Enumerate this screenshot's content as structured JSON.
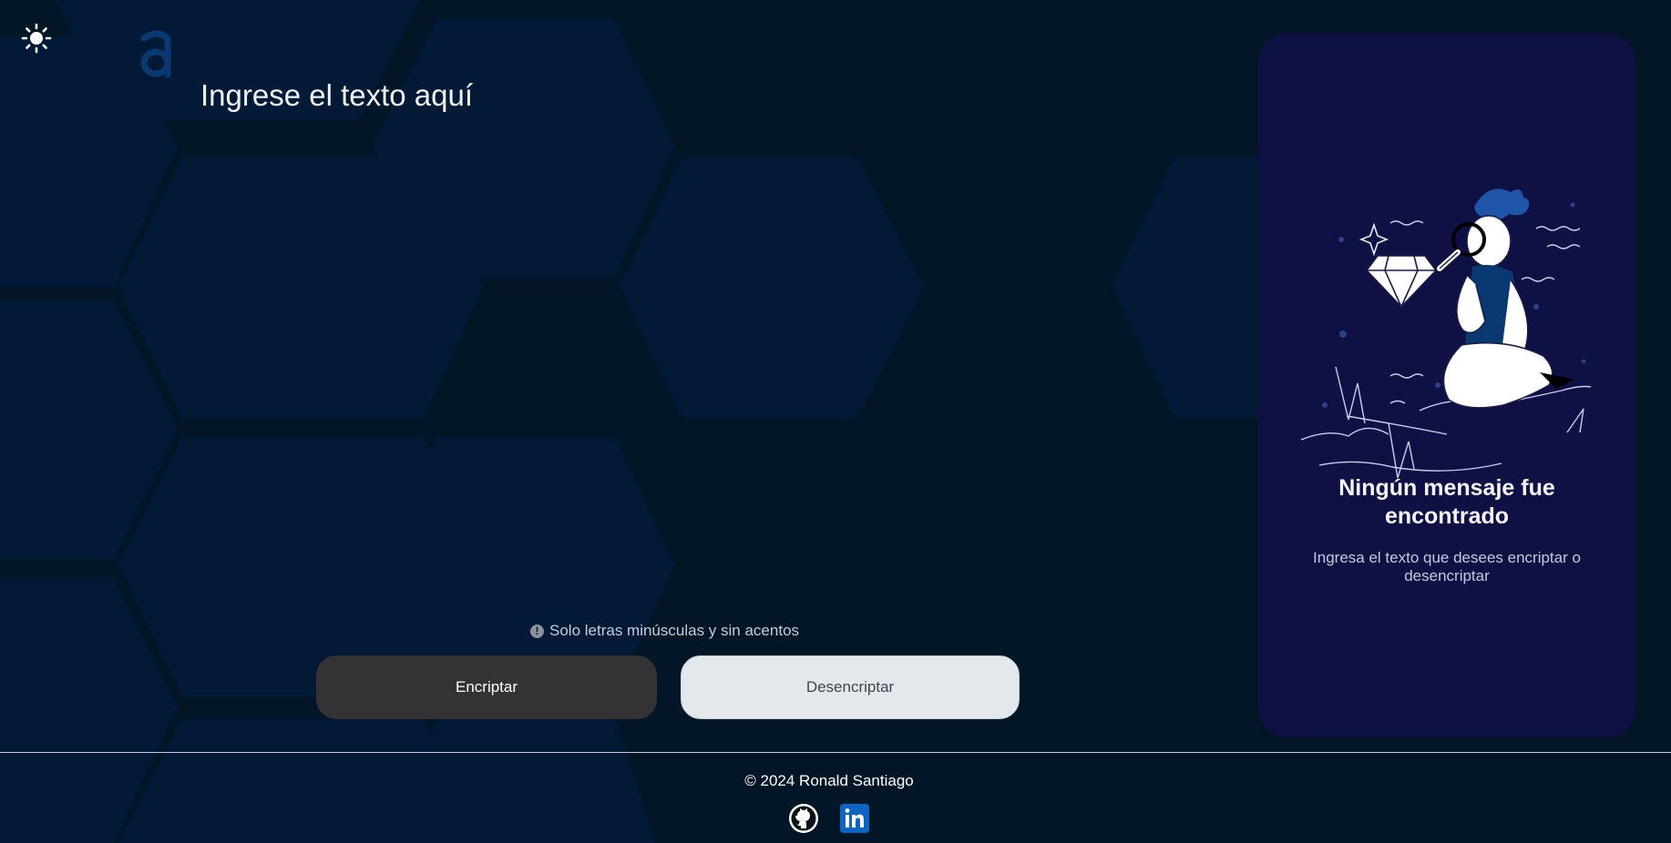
{
  "app": {
    "theme_toggle_icon": "sun-icon",
    "logo_icon": "alura-logo-icon",
    "accent_color": "#0a3871"
  },
  "editor": {
    "placeholder": "Ingrese el texto aquí",
    "value": ""
  },
  "hint": {
    "icon": "exclamation-circle-icon",
    "text": "Solo letras minúsculas y sin acentos"
  },
  "actions": {
    "encrypt_label": "Encriptar",
    "decrypt_label": "Desencriptar",
    "encrypt_color": "#353236",
    "decrypt_color": "#e3e8ed"
  },
  "result_panel": {
    "illustration": "person-with-magnifying-glass-and-diamond",
    "title": "Ningún mensaje fue encontrado",
    "subtitle": "Ingresa el texto que desees encriptar o desencriptar",
    "background": "#0f1145"
  },
  "footer": {
    "copyright": "© 2024 Ronald Santiago",
    "links": [
      {
        "name": "github",
        "icon": "github-icon"
      },
      {
        "name": "linkedin",
        "icon": "linkedin-icon"
      }
    ]
  }
}
